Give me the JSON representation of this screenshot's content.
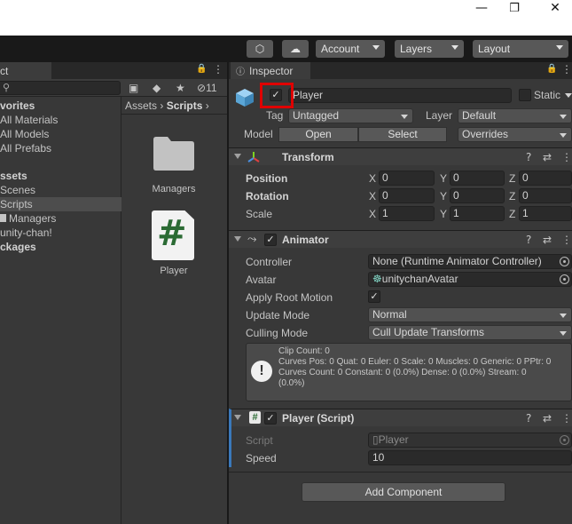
{
  "window": {
    "minimize_icon": "—",
    "maximize_icon": "❐",
    "close_icon": "✕"
  },
  "toolbar": {
    "collab_icon": "⬡",
    "cloud_icon": "☁",
    "account": "Account",
    "layers": "Layers",
    "layout": "Layout"
  },
  "project": {
    "tab_label": "ct",
    "lock_icon": "🔒",
    "menu_icon": "⋮",
    "search_icon": "⚲",
    "hidden_count": "11",
    "tree": [
      {
        "label": "vorites",
        "bold": true
      },
      {
        "label": "All Materials",
        "bold": false
      },
      {
        "label": "All Models",
        "bold": false
      },
      {
        "label": "All Prefabs",
        "bold": false
      },
      {
        "label": "ssets",
        "bold": true
      },
      {
        "label": "Scenes",
        "bold": false
      },
      {
        "label": "Scripts",
        "bold": false,
        "selected": true
      },
      {
        "label": "Managers",
        "bold": false
      },
      {
        "label": "unity-chan!",
        "bold": false
      },
      {
        "label": "ckages",
        "bold": true
      }
    ],
    "breadcrumb": {
      "root": "Assets",
      "sep": "›",
      "current": "Scripts",
      "tail": "›"
    },
    "assets": [
      {
        "name": "Managers",
        "type": "folder"
      },
      {
        "name": "Player",
        "type": "script",
        "glyph": "#"
      }
    ]
  },
  "inspector": {
    "tab_label": "Inspector",
    "object": {
      "active": "✓",
      "name": "Player",
      "static_label": "Static",
      "tag_label": "Tag",
      "tag_value": "Untagged",
      "layer_label": "Layer",
      "layer_value": "Default",
      "model_label": "Model",
      "open_btn": "Open",
      "select_btn": "Select",
      "overrides": "Overrides"
    },
    "transform": {
      "title": "Transform",
      "rows": [
        {
          "label": "Position",
          "x": "0",
          "y": "0",
          "z": "0"
        },
        {
          "label": "Rotation",
          "x": "0",
          "y": "0",
          "z": "0"
        },
        {
          "label": "Scale",
          "x": "1",
          "y": "1",
          "z": "1"
        }
      ],
      "axis_x": "X",
      "axis_y": "Y",
      "axis_z": "Z"
    },
    "animator": {
      "title": "Animator",
      "enabled": "✓",
      "controller_label": "Controller",
      "controller_value": "None (Runtime Animator Controller)",
      "avatar_label": "Avatar",
      "avatar_value": "unitychanAvatar",
      "root_motion_label": "Apply Root Motion",
      "root_motion_value": "✓",
      "update_label": "Update Mode",
      "update_value": "Normal",
      "culling_label": "Culling Mode",
      "culling_value": "Cull Update Transforms",
      "help_icon": "!",
      "info": [
        "Clip Count: 0",
        "Curves Pos: 0 Quat: 0 Euler: 0 Scale: 0 Muscles: 0 Generic: 0 PPtr: 0",
        "Curves Count: 0 Constant: 0 (0.0%) Dense: 0 (0.0%) Stream: 0",
        "(0.0%)"
      ]
    },
    "script": {
      "title": "Player (Script)",
      "enabled": "✓",
      "script_label": "Script",
      "script_value": "Player",
      "speed_label": "Speed",
      "speed_value": "10"
    },
    "component_tools": {
      "help": "?",
      "settings": "⇄",
      "menu": "⋮"
    },
    "add_component": "Add Component"
  }
}
